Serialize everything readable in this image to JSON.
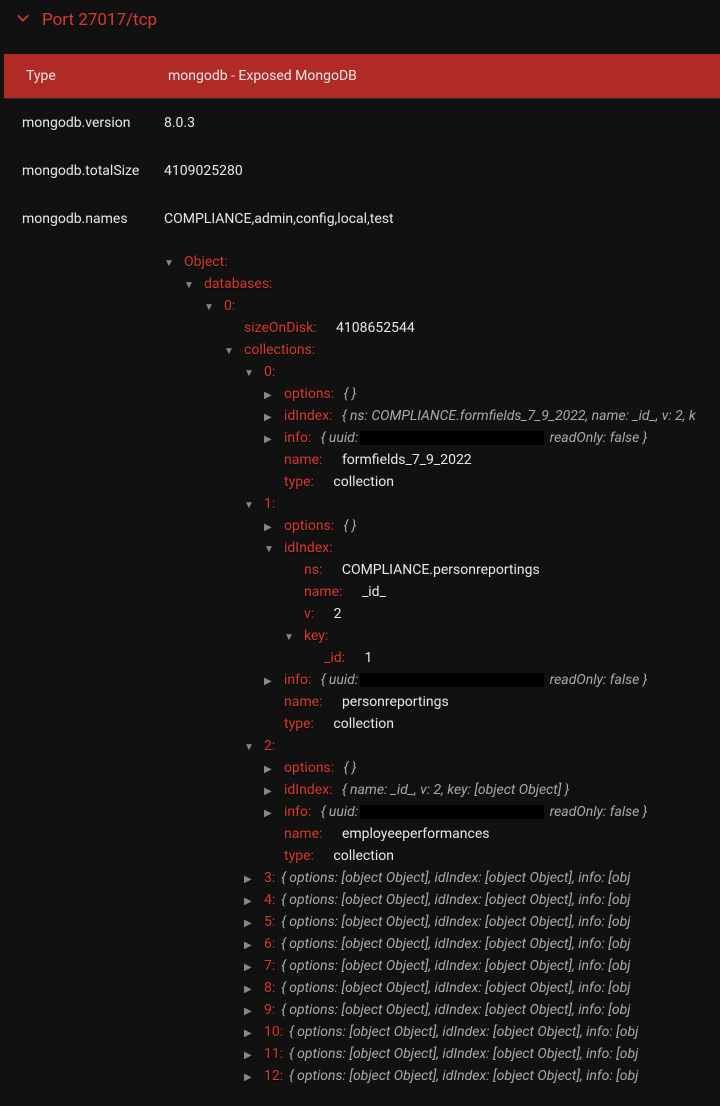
{
  "header": {
    "title": "Port 27017/tcp"
  },
  "infoRows": {
    "typeKey": "Type",
    "typeVal": "mongodb - Exposed MongoDB",
    "versionKey": "mongodb.version",
    "versionVal": "8.0.3",
    "totalSizeKey": "mongodb.totalSize",
    "totalSizeVal": "4109025280",
    "namesKey": "mongodb.names",
    "namesVal": "COMPLIANCE,admin,config,local,test"
  },
  "tree": {
    "objectKey": "Object:",
    "databasesKey": "databases:",
    "idx0": "0:",
    "sizeOnDiskKey": "sizeOnDisk:",
    "sizeOnDiskVal": "4108652544",
    "collectionsKey": "collections:",
    "c0": {
      "idx": "0:",
      "optionsKey": "options:",
      "optionsVal": "{ }",
      "idIndexKey": "idIndex:",
      "idIndexVal": "{ ns: COMPLIANCE.formfields_7_9_2022, name: _id_, v: 2, k",
      "infoKey": "info:",
      "infoPrefix": "{ uuid:",
      "infoSuffix": " readOnly: false }",
      "nameKey": "name:",
      "nameVal": "formfields_7_9_2022",
      "typeKey": "type:",
      "typeVal": "collection"
    },
    "c1": {
      "idx": "1:",
      "optionsKey": "options:",
      "optionsVal": "{ }",
      "idIndexKey": "idIndex:",
      "nsKey": "ns:",
      "nsVal": "COMPLIANCE.personreportings",
      "nameIdxKey": "name:",
      "nameIdxVal": "_id_",
      "vKey": "v:",
      "vVal": "2",
      "keyKey": "key:",
      "idKey": "_id:",
      "idVal": "1",
      "infoKey": "info:",
      "infoPrefix": "{ uuid:",
      "infoSuffix": " readOnly: false }",
      "nameKey": "name:",
      "nameVal": "personreportings",
      "typeKey": "type:",
      "typeVal": "collection"
    },
    "c2": {
      "idx": "2:",
      "optionsKey": "options:",
      "optionsVal": "{ }",
      "idIndexKey": "idIndex:",
      "idIndexVal": "{ name: _id_, v: 2, key: [object Object] }",
      "infoKey": "info:",
      "infoPrefix": "{ uuid:",
      "infoSuffix": " readOnly: false }",
      "nameKey": "name:",
      "nameVal": "employeeperformances",
      "typeKey": "type:",
      "typeVal": "collection"
    },
    "collapsed": {
      "i3": "3:",
      "i4": "4:",
      "i5": "5:",
      "i6": "6:",
      "i7": "7:",
      "i8": "8:",
      "i9": "9:",
      "i10": "10:",
      "i11": "11:",
      "i12": "12:",
      "summary": "{ options: [object Object], idIndex: [object Object], info: [obj"
    }
  }
}
